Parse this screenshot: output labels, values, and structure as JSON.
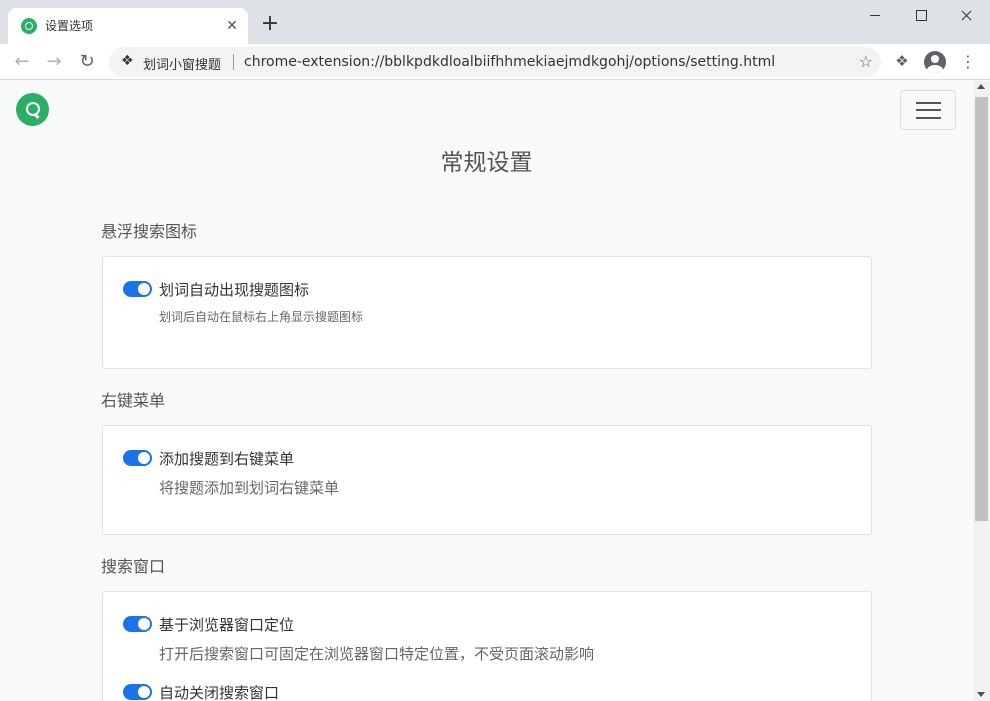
{
  "browser": {
    "tab_title": "设置选项",
    "tab_close_glyph": "✕",
    "new_tab_glyph": "+",
    "extension_name": "划词小窗搜题",
    "url": "chrome-extension://bblkpdkdloalbiifhhmekiaejmdkgohj/options/setting.html",
    "icons": [
      "back-arrow-icon",
      "forward-arrow-icon",
      "reload-icon",
      "puzzle-icon",
      "star-icon",
      "profile-icon",
      "kebab-menu-icon"
    ]
  },
  "page": {
    "title": "常规设置",
    "accent_color": "#2bae66",
    "toggle_color": "#1a73e8"
  },
  "sections": [
    {
      "title": "悬浮搜索图标",
      "options": [
        {
          "label": "划词自动出现搜题图标",
          "description": "划词后自动在鼠标右上角显示搜题图标",
          "enabled": true
        }
      ]
    },
    {
      "title": "右键菜单",
      "options": [
        {
          "label": "添加搜题到右键菜单",
          "description": "将搜题添加到划词右键菜单",
          "enabled": true
        }
      ]
    },
    {
      "title": "搜索窗口",
      "options": [
        {
          "label": "基于浏览器窗口定位",
          "description": "打开后搜索窗口可固定在浏览器窗口特定位置，不受页面滚动影响",
          "enabled": true
        },
        {
          "label": "自动关闭搜索窗口",
          "enabled": true
        }
      ]
    }
  ]
}
